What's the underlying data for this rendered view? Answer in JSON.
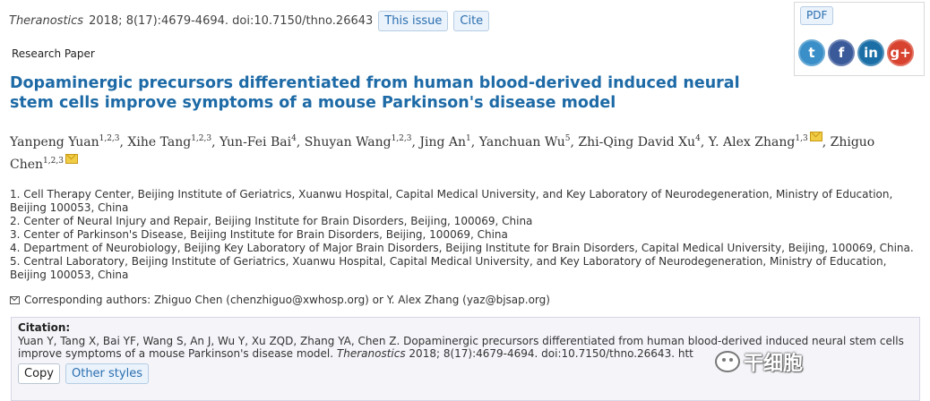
{
  "header": {
    "journal": "Theranostics",
    "citation_line": "2018; 8(17):4679-4694. doi:10.7150/thno.26643",
    "this_issue_label": "This issue",
    "cite_label": "Cite"
  },
  "article_type": "Research Paper",
  "title_lines": [
    "Dopaminergic precursors differentiated from human blood-derived induced neural",
    "stem cells improve symptoms of a mouse Parkinson's disease model"
  ],
  "authors": [
    {
      "name": "Yanpeng Yuan",
      "aff": "1,2,3",
      "mail": false
    },
    {
      "name": "Xihe Tang",
      "aff": "1,2,3",
      "mail": false
    },
    {
      "name": "Yun-Fei Bai",
      "aff": "4",
      "mail": false
    },
    {
      "name": "Shuyan Wang",
      "aff": "1,2,3",
      "mail": false
    },
    {
      "name": "Jing An",
      "aff": "1",
      "mail": false
    },
    {
      "name": "Yanchuan Wu",
      "aff": "5",
      "mail": false
    },
    {
      "name": "Zhi-Qing David Xu",
      "aff": "4",
      "mail": false
    },
    {
      "name": "Y. Alex Zhang",
      "aff": "1,3",
      "mail": true
    },
    {
      "name": "Zhiguo Chen",
      "aff": "1,2,3",
      "mail": true
    }
  ],
  "affiliations": [
    "1. Cell Therapy Center, Beijing Institute of Geriatrics, Xuanwu Hospital, Capital Medical University, and Key Laboratory of Neurodegeneration, Ministry of Education,",
    "Beijing 100053, China",
    "2. Center of Neural Injury and Repair, Beijing Institute for Brain Disorders, Beijing, 100069, China",
    "3. Center of Parkinson's Disease, Beijing Institute for Brain Disorders, Beijing, 100069, China",
    "4. Department of Neurobiology, Beijing Key Laboratory of Major Brain Disorders, Beijing Institute for Brain Disorders, Capital Medical University, Beijing, 100069, China.",
    "5. Central Laboratory, Beijing Institute of Geriatrics, Xuanwu Hospital, Capital Medical University, and Key Laboratory of Neurodegeneration, Ministry of Education,",
    "Beijing 100053, China"
  ],
  "corresponding": "Corresponding authors: Zhiguo Chen (chenzhiguo@xwhosp.org) or Y. Alex Zhang (yaz@bjsap.org)",
  "citation": {
    "label": "Citation:",
    "line1": "Yuan Y, Tang X, Bai YF, Wang S, An J, Wu Y, Xu ZQD, Zhang YA, Chen Z. Dopaminergic precursors differentiated from human blood-derived induced neural stem cells",
    "line2_pre": "improve symptoms of a mouse Parkinson's disease model.",
    "line2_journal": "Theranostics",
    "line2_post": "2018; 8(17):4679-4694. doi:10.7150/thno.26643. htt",
    "copy_label": "Copy",
    "other_styles_label": "Other styles"
  },
  "side_panel": {
    "pdf_label": "PDF",
    "socials": [
      {
        "name": "twitter-icon",
        "glyph": "t",
        "color": "#3a8fc8"
      },
      {
        "name": "facebook-icon",
        "glyph": "f",
        "color": "#3b5a9a"
      },
      {
        "name": "linkedin-icon",
        "glyph": "in",
        "color": "#1b6fa6"
      },
      {
        "name": "google-plus-icon",
        "glyph": "g+",
        "color": "#d8432f"
      }
    ]
  },
  "watermark": "干细胞"
}
